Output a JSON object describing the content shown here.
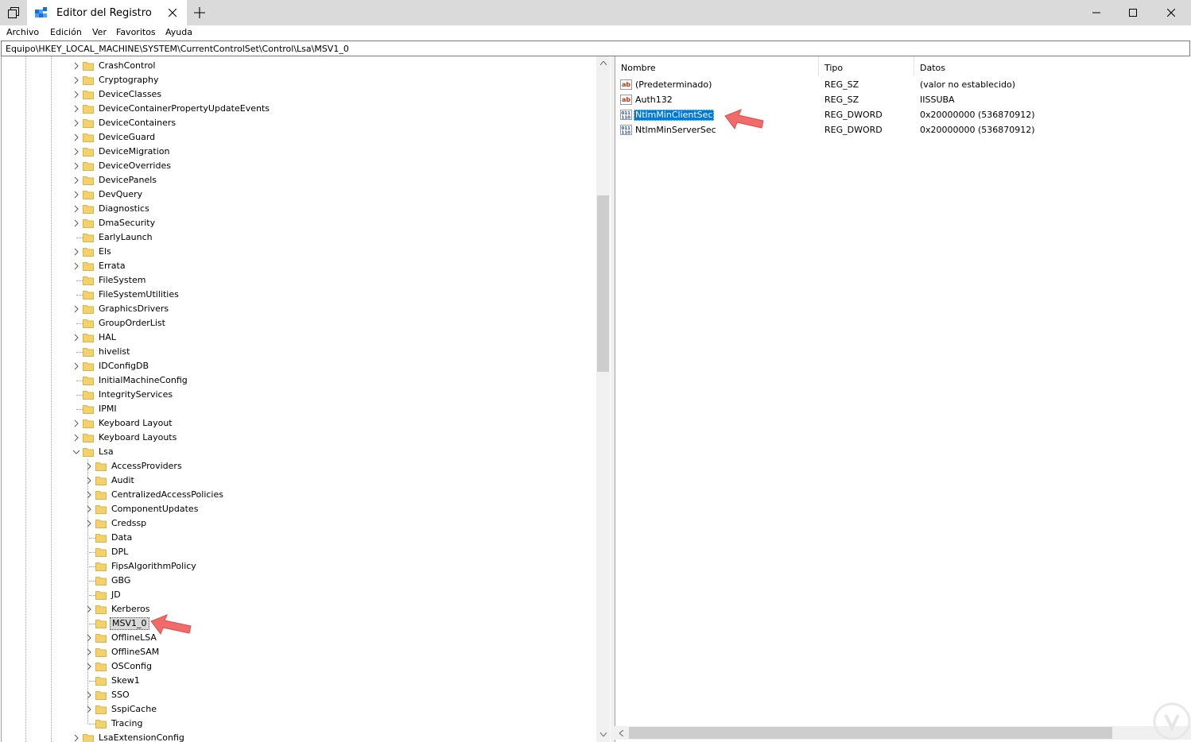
{
  "window": {
    "tab_title": "Editor del Registro"
  },
  "menu": [
    "Archivo",
    "Edición",
    "Ver",
    "Favoritos",
    "Ayuda"
  ],
  "address": "Equipo\\HKEY_LOCAL_MACHINE\\SYSTEM\\CurrentControlSet\\Control\\Lsa\\MSV1_0",
  "tree": {
    "level1": [
      {
        "label": "CrashControl",
        "expandable": true
      },
      {
        "label": "Cryptography",
        "expandable": true
      },
      {
        "label": "DeviceClasses",
        "expandable": true
      },
      {
        "label": "DeviceContainerPropertyUpdateEvents",
        "expandable": true
      },
      {
        "label": "DeviceContainers",
        "expandable": true
      },
      {
        "label": "DeviceGuard",
        "expandable": true
      },
      {
        "label": "DeviceMigration",
        "expandable": true
      },
      {
        "label": "DeviceOverrides",
        "expandable": true
      },
      {
        "label": "DevicePanels",
        "expandable": true
      },
      {
        "label": "DevQuery",
        "expandable": true
      },
      {
        "label": "Diagnostics",
        "expandable": true
      },
      {
        "label": "DmaSecurity",
        "expandable": true
      },
      {
        "label": "EarlyLaunch",
        "expandable": false
      },
      {
        "label": "Els",
        "expandable": true
      },
      {
        "label": "Errata",
        "expandable": true
      },
      {
        "label": "FileSystem",
        "expandable": false
      },
      {
        "label": "FileSystemUtilities",
        "expandable": false
      },
      {
        "label": "GraphicsDrivers",
        "expandable": true
      },
      {
        "label": "GroupOrderList",
        "expandable": false
      },
      {
        "label": "HAL",
        "expandable": true
      },
      {
        "label": "hivelist",
        "expandable": false
      },
      {
        "label": "IDConfigDB",
        "expandable": true
      },
      {
        "label": "InitialMachineConfig",
        "expandable": false
      },
      {
        "label": "IntegrityServices",
        "expandable": false
      },
      {
        "label": "IPMI",
        "expandable": false
      },
      {
        "label": "Keyboard Layout",
        "expandable": true
      },
      {
        "label": "Keyboard Layouts",
        "expandable": true
      },
      {
        "label": "Lsa",
        "expanded": true
      }
    ],
    "lsa_children": [
      {
        "label": "AccessProviders",
        "expandable": true
      },
      {
        "label": "Audit",
        "expandable": true
      },
      {
        "label": "CentralizedAccessPolicies",
        "expandable": true
      },
      {
        "label": "ComponentUpdates",
        "expandable": true
      },
      {
        "label": "Credssp",
        "expandable": true
      },
      {
        "label": "Data",
        "expandable": false
      },
      {
        "label": "DPL",
        "expandable": false
      },
      {
        "label": "FipsAlgorithmPolicy",
        "expandable": false
      },
      {
        "label": "GBG",
        "expandable": false
      },
      {
        "label": "JD",
        "expandable": false
      },
      {
        "label": "Kerberos",
        "expandable": true
      },
      {
        "label": "MSV1_0",
        "expandable": false,
        "selected": true
      },
      {
        "label": "OfflineLSA",
        "expandable": true
      },
      {
        "label": "OfflineSAM",
        "expandable": true
      },
      {
        "label": "OSConfig",
        "expandable": true
      },
      {
        "label": "Skew1",
        "expandable": false
      },
      {
        "label": "SSO",
        "expandable": true
      },
      {
        "label": "SspiCache",
        "expandable": true
      },
      {
        "label": "Tracing",
        "expandable": false
      }
    ],
    "after": [
      {
        "label": "LsaExtensionConfig",
        "expandable": true
      }
    ]
  },
  "list": {
    "columns": [
      "Nombre",
      "Tipo",
      "Datos"
    ],
    "rows": [
      {
        "icon": "string-value-icon",
        "name": "(Predeterminado)",
        "type": "REG_SZ",
        "data": "(valor no establecido)"
      },
      {
        "icon": "string-value-icon",
        "name": "Auth132",
        "type": "REG_SZ",
        "data": "IISSUBA"
      },
      {
        "icon": "dword-value-icon",
        "name": "NtlmMinClientSec",
        "type": "REG_DWORD",
        "data": "0x20000000 (536870912)",
        "selected": true
      },
      {
        "icon": "dword-value-icon",
        "name": "NtlmMinServerSec",
        "type": "REG_DWORD",
        "data": "0x20000000 (536870912)"
      }
    ]
  },
  "colors": {
    "selection": "#0078d7",
    "folder": "#f3d26b",
    "annotation_arrow": "#f26b6b"
  }
}
